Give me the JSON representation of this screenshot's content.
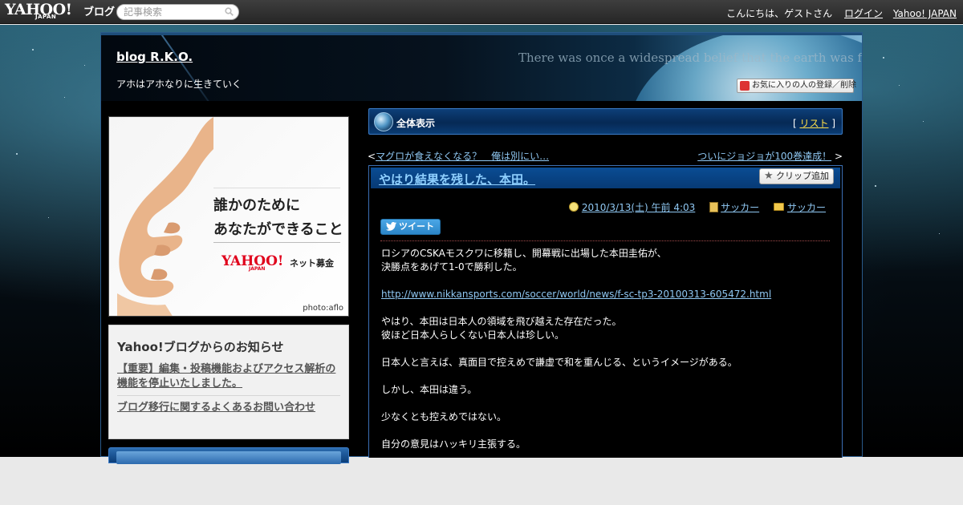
{
  "topbar": {
    "logo": "YAHOO!",
    "logo_sub": "JAPAN",
    "logo_blog": "ブログ",
    "search_placeholder": "記事検索",
    "greeting": "こんにちは、ゲストさん",
    "login": "ログイン",
    "yahoo_japan": "Yahoo! JAPAN"
  },
  "header": {
    "blog_title": "blog R.K.O.",
    "description": "アホはアホなりに生きていく",
    "motto": "There was once a widespread belief that the earth was flat",
    "favorite_button": "お気に入りの人の登録／削除"
  },
  "sidebar": {
    "ad": {
      "line1": "誰かのために",
      "line2": "あなたができること",
      "brand": "YAHOO!",
      "brand_sub": "JAPAN",
      "service": "ネット募金",
      "credit": "photo:aflo"
    },
    "notice": {
      "title": "Yahoo!ブログからのお知らせ",
      "links": [
        "【重要】編集・投稿機能およびアクセス解析の機能を停止いたしました。",
        "ブログ移行に関するよくあるお問い合わせ"
      ]
    }
  },
  "section": {
    "title": "全体表示",
    "list_prefix": "[ ",
    "list_label": "リスト",
    "list_suffix": " ]"
  },
  "nav": {
    "prev_mark": "<",
    "prev_label": "マグロが食えなくなる？　俺は別にい…",
    "next_label": "ついにジョジョが100巻達成！",
    "next_mark": ">"
  },
  "post": {
    "title": "やはり結果を残した、本田。",
    "clip_button": "クリップ追加",
    "date": "2010/3/13(土) 午前 4:03",
    "category1": "サッカー",
    "category2": "サッカー",
    "tweet": "ツイート",
    "body": [
      "ロシアのCSKAモスクワに移籍し、開幕戦に出場した本田圭佑が、",
      "決勝点をあげて1-0で勝利した。",
      "",
      "http://www.nikkansports.com/soccer/world/news/f-sc-tp3-20100313-605472.html",
      "",
      "やはり、本田は日本人の領域を飛び越えた存在だった。",
      "彼ほど日本人らしくない日本人は珍しい。",
      "",
      "日本人と言えば、真面目で控えめで謙虚で和を重んじる、というイメージがある。",
      "",
      "しかし、本田は違う。",
      "",
      "少なくとも控えめではない。",
      "",
      "自分の意見はハッキリ主張する。"
    ]
  },
  "colors": {
    "link_blue": "#8fc7f2",
    "section_bar": "#062955",
    "list_link": "#ffe04a",
    "notice_bg": "#f1f1f1"
  },
  "icons": [
    "search-icon",
    "globe-icon",
    "star-icon",
    "clock-icon",
    "book-icon",
    "folder-icon",
    "bird-icon",
    "heart-icon"
  ]
}
